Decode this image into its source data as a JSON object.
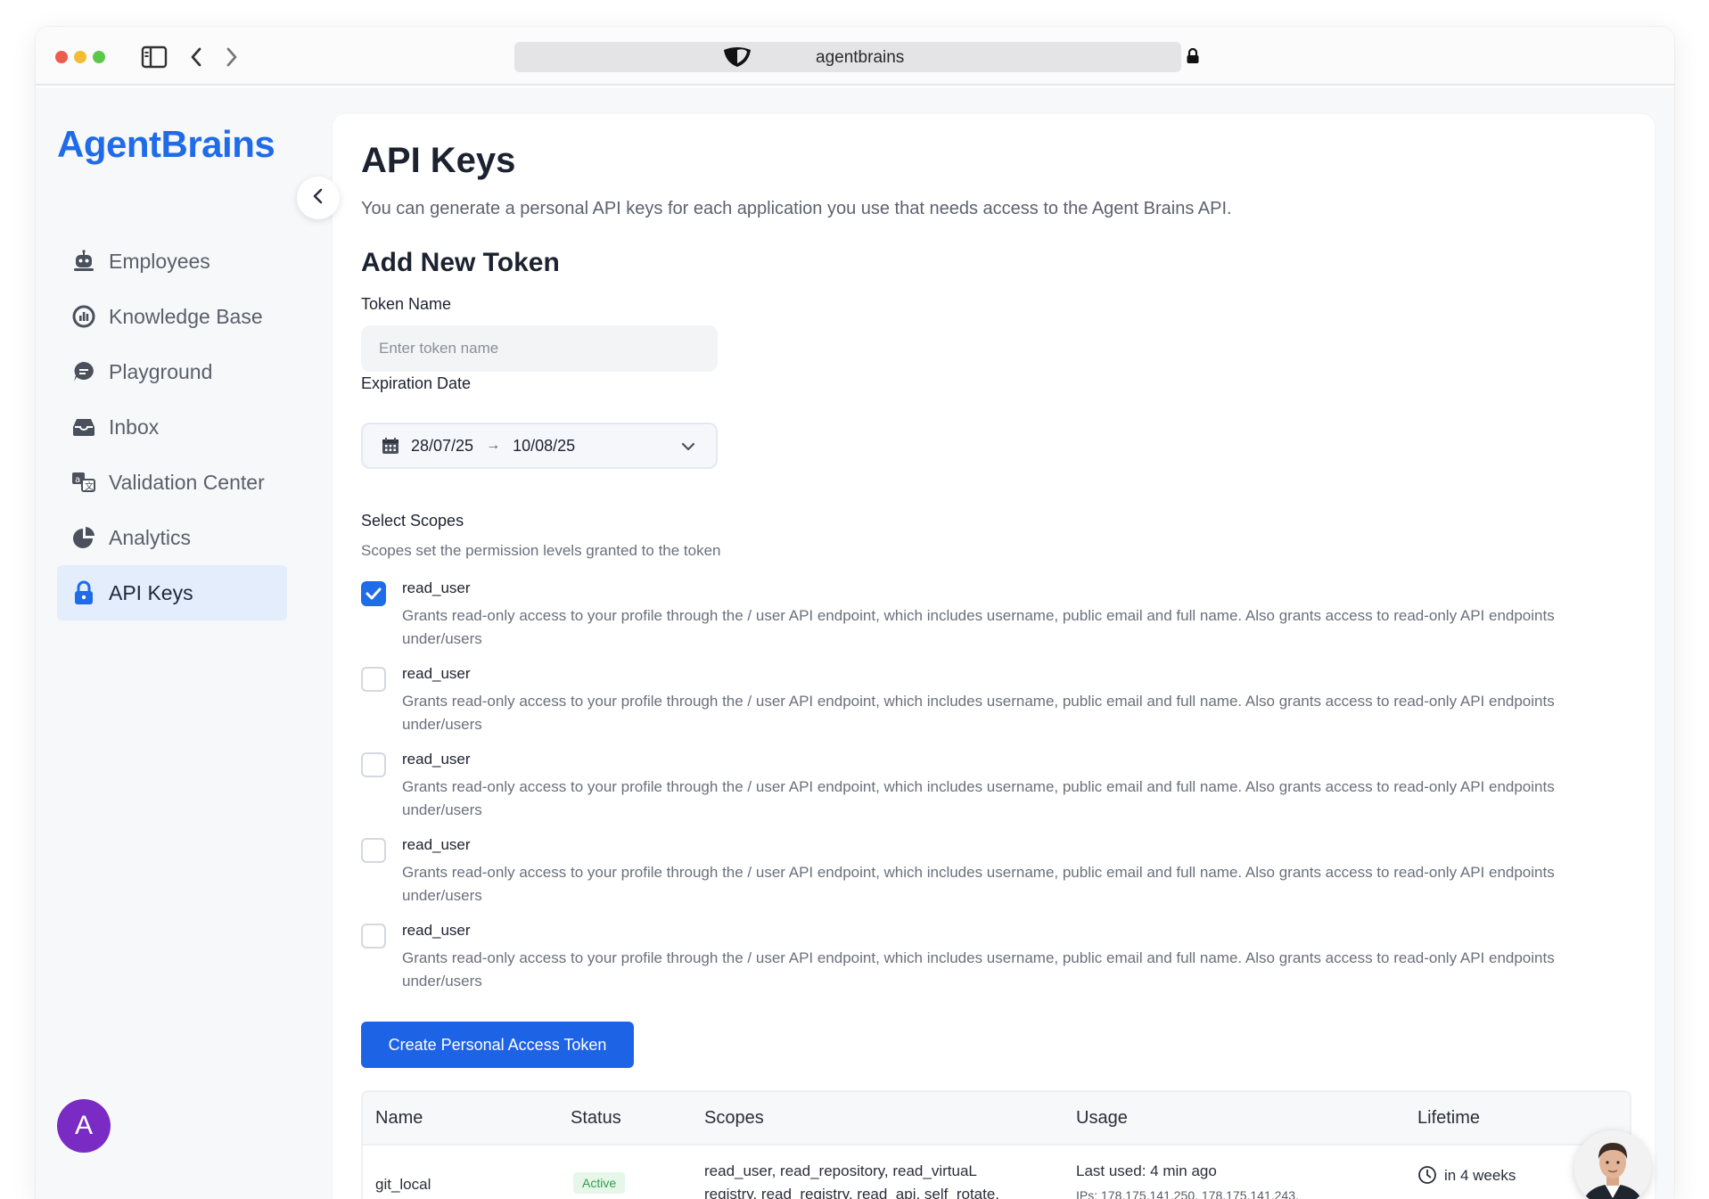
{
  "browser": {
    "url_text": "agentbrains"
  },
  "sidebar": {
    "logo": "AgentBrains",
    "items": [
      {
        "label": "Employees",
        "icon": "robot-icon"
      },
      {
        "label": "Knowledge Base",
        "icon": "chart-circle-icon"
      },
      {
        "label": "Playground",
        "icon": "chat-bubble-icon"
      },
      {
        "label": "Inbox",
        "icon": "inbox-tray-icon"
      },
      {
        "label": "Validation Center",
        "icon": "translate-icon"
      },
      {
        "label": "Analytics",
        "icon": "pie-chart-icon"
      },
      {
        "label": "API Keys",
        "icon": "lock-icon",
        "active": true
      }
    ],
    "avatar_letter": "A",
    "avatar_color": "#7a2bc4"
  },
  "main": {
    "title": "API Keys",
    "subtitle": "You can generate a personal API keys for each application you use that needs access to the Agent Brains API.",
    "form_title": "Add New Token",
    "token_name_label": "Token Name",
    "token_name_placeholder": "Enter token name",
    "token_name_value": "",
    "expiration_label": "Expiration Date",
    "expiration_start": "28/07/25",
    "expiration_arrow": "→",
    "expiration_end": "10/08/25",
    "scopes_label": "Select Scopes",
    "scopes_hint": "Scopes set the permission levels granted to the token",
    "scopes": [
      {
        "name": "read_user",
        "checked": true,
        "description": "Grants read-only access to your profile through the / user API endpoint, which includes username, public email and full name. Also grants access to read-only API endpoints under/users"
      },
      {
        "name": "read_user",
        "checked": false,
        "description": "Grants read-only access to your profile through the / user API endpoint, which includes username, public email and full name. Also grants access to read-only API endpoints under/users"
      },
      {
        "name": "read_user",
        "checked": false,
        "description": "Grants read-only access to your profile through the / user API endpoint, which includes username, public email and full name. Also grants access to read-only API endpoints under/users"
      },
      {
        "name": "read_user",
        "checked": false,
        "description": "Grants read-only access to your profile through the / user API endpoint, which includes username, public email and full name. Also grants access to read-only API endpoints under/users"
      },
      {
        "name": "read_user",
        "checked": false,
        "description": "Grants read-only access to your profile through the / user API endpoint, which includes username, public email and full name. Also grants access to read-only API endpoints under/users"
      }
    ],
    "create_button": "Create Personal Access Token"
  },
  "table": {
    "headers": [
      "Name",
      "Status",
      "Scopes",
      "Usage",
      "Lifetime"
    ],
    "rows": [
      {
        "name": "git_local",
        "status": "Active",
        "scopes_line1": "read_user, read_repository, read_virtuaL",
        "scopes_line2": "registry, read_registry, read_api, self_rotate,",
        "usage": "Last used: 4 min ago",
        "ips": "IPs: 178.175.141.250, 178.175.141.243,",
        "lifetime": "in 4 weeks"
      }
    ]
  },
  "colors": {
    "accent": "#1f6be8",
    "active_nav_bg": "#e3edfc",
    "status_active": "#2f9e4b"
  }
}
